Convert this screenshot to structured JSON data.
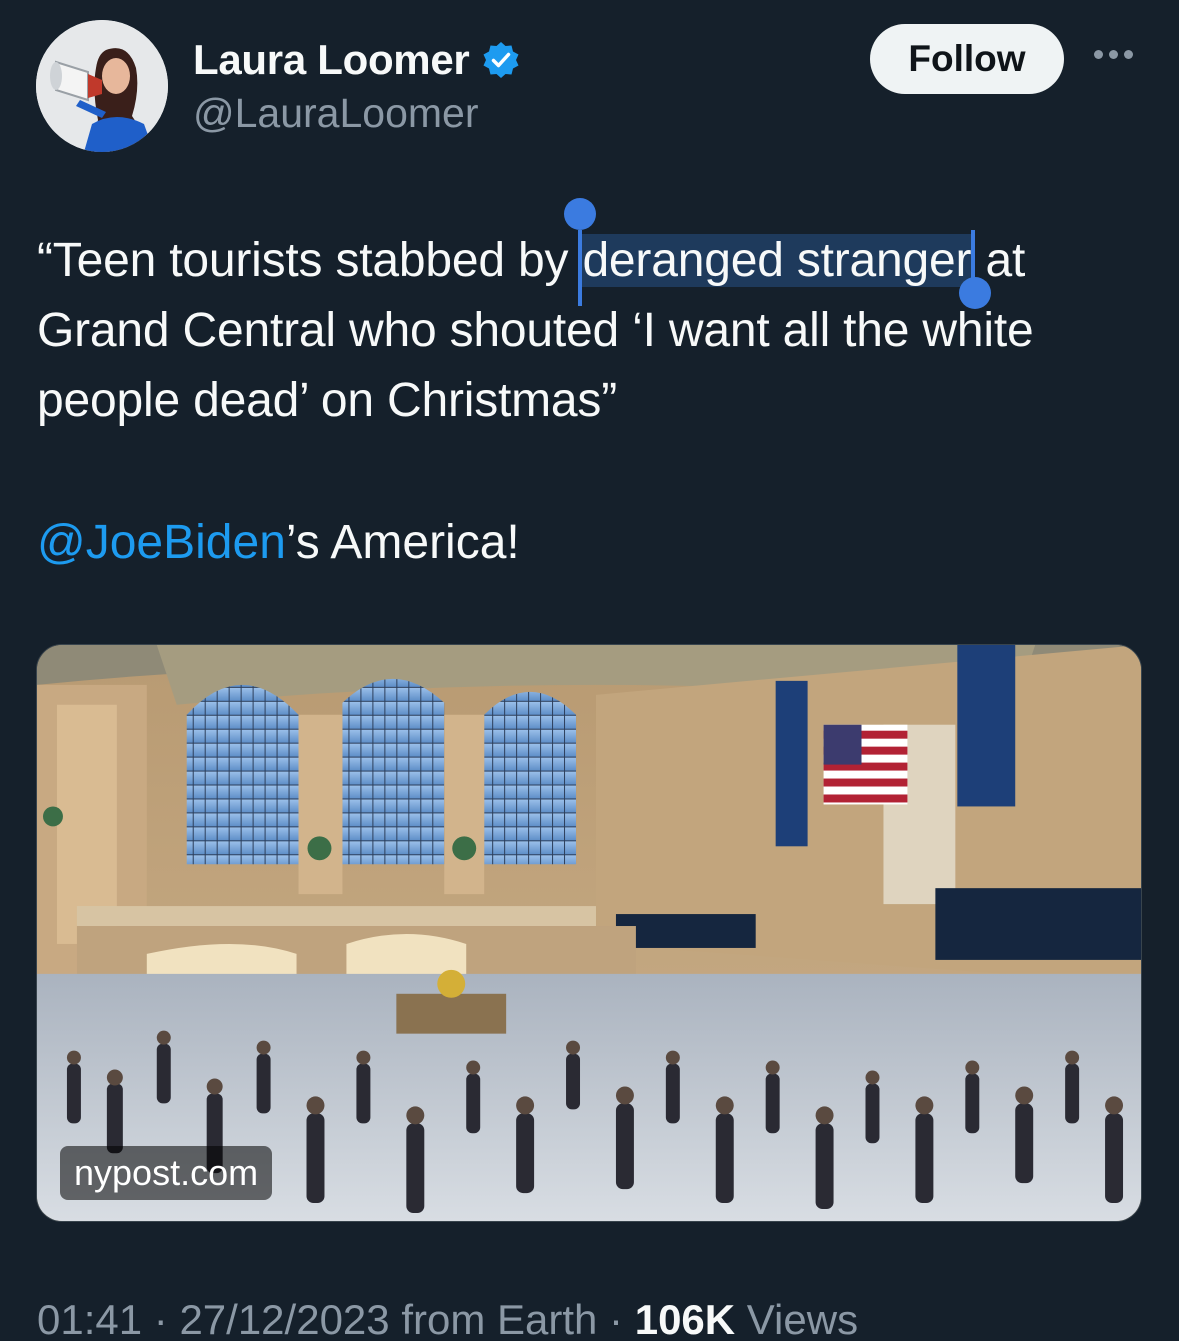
{
  "author": {
    "display_name": "Laura Loomer",
    "handle": "@LauraLoomer",
    "verified": true,
    "verified_color": "#1d9bf0"
  },
  "actions": {
    "follow_label": "Follow",
    "more_icon": "more-horizontal-icon"
  },
  "tweet": {
    "line1_pre": "“Teen tourists stabbed by ",
    "line1_selected": "deranged stranger",
    "line1_post": " at",
    "line2": "Grand Central who shouted ‘I want all the white",
    "line3": "people dead’ on Christmas”",
    "mention": "@JoeBiden",
    "mention_suffix": "’s America!"
  },
  "media": {
    "source": "nypost.com"
  },
  "meta": {
    "time": "01:41",
    "separator": " · ",
    "date": "27/12/2023",
    "from_label": "from Earth",
    "views_count": "106K",
    "views_label": "Views"
  },
  "colors": {
    "background": "#15202b",
    "text": "#f7f9f9",
    "secondary_text": "#8b98a5",
    "link": "#1d9bf0",
    "selection": "#1e3a5c",
    "selection_handle": "#3b7be0"
  }
}
